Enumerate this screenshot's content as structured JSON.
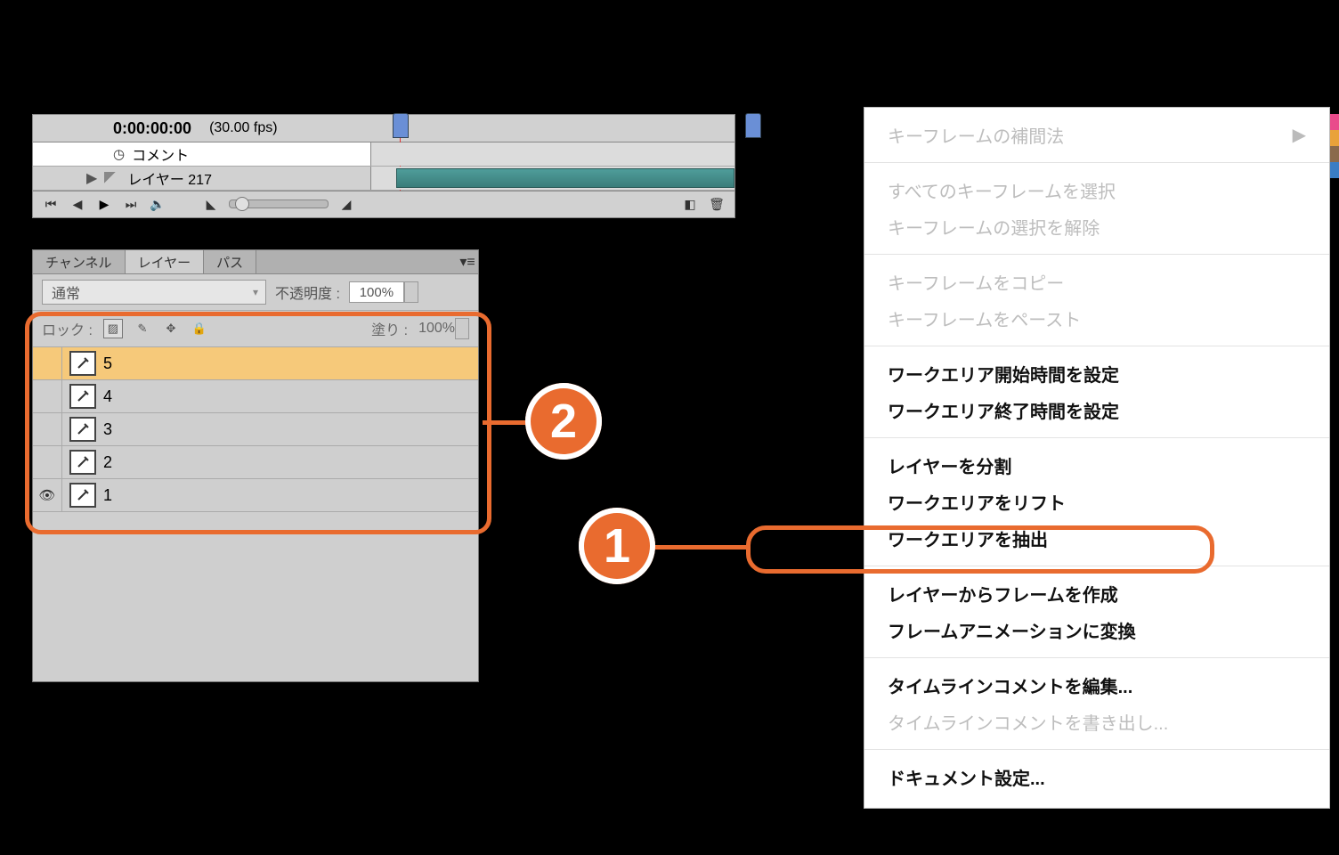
{
  "timeline": {
    "timecode": "0:00:00:00",
    "fps": "(30.00 fps)",
    "comment_row_label": "コメント",
    "layer_row_label": "レイヤー 217"
  },
  "layers_panel": {
    "tabs": {
      "channel": "チャンネル",
      "layer": "レイヤー",
      "path": "パス"
    },
    "blend_mode": "通常",
    "opacity_label": "不透明度 :",
    "opacity_value": "100%",
    "lock_label": "ロック :",
    "fill_label": "塗り :",
    "fill_value": "100%",
    "layers": [
      {
        "name": "5",
        "selected": true,
        "visible": false
      },
      {
        "name": "4",
        "selected": false,
        "visible": false
      },
      {
        "name": "3",
        "selected": false,
        "visible": false
      },
      {
        "name": "2",
        "selected": false,
        "visible": false
      },
      {
        "name": "1",
        "selected": false,
        "visible": true
      }
    ]
  },
  "context_menu": {
    "items": [
      {
        "label": "キーフレームの補間法",
        "disabled": true,
        "submenu": true
      },
      {
        "sep": true
      },
      {
        "label": "すべてのキーフレームを選択",
        "disabled": true
      },
      {
        "label": "キーフレームの選択を解除",
        "disabled": true
      },
      {
        "sep": true
      },
      {
        "label": "キーフレームをコピー",
        "disabled": true
      },
      {
        "label": "キーフレームをペースト",
        "disabled": true
      },
      {
        "sep": true
      },
      {
        "label": "ワークエリア開始時間を設定",
        "bold": true
      },
      {
        "label": "ワークエリア終了時間を設定",
        "bold": true
      },
      {
        "sep": true
      },
      {
        "label": "レイヤーを分割",
        "bold": true
      },
      {
        "label": "ワークエリアをリフト",
        "bold": true
      },
      {
        "label": "ワークエリアを抽出",
        "bold": true
      },
      {
        "sep": true
      },
      {
        "label": "レイヤーからフレームを作成",
        "bold": true
      },
      {
        "label": "フレームアニメーションに変換",
        "bold": true,
        "highlight": true
      },
      {
        "sep": true
      },
      {
        "label": "タイムラインコメントを編集...",
        "bold": true
      },
      {
        "label": "タイムラインコメントを書き出し...",
        "disabled": true
      },
      {
        "sep": true
      },
      {
        "label": "ドキュメント設定...",
        "bold": true
      }
    ]
  },
  "badges": {
    "one": "1",
    "two": "2"
  },
  "color_strip": [
    "#e94b8b",
    "#e9a23a",
    "#8a6a4b",
    "#3a7dc4"
  ]
}
